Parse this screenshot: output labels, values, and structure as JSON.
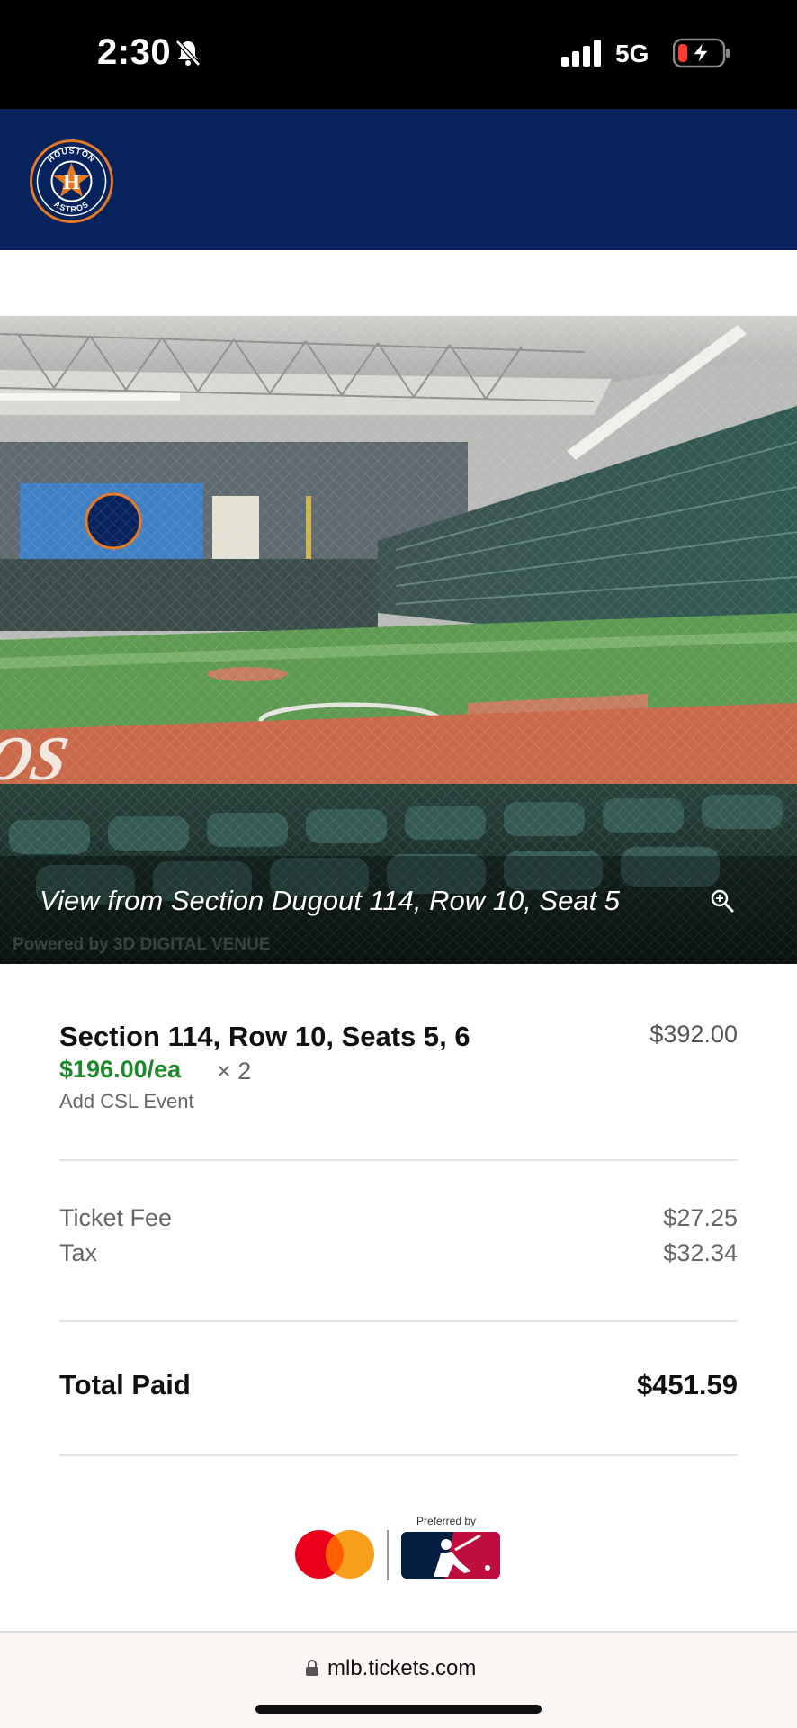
{
  "status_bar": {
    "time": "2:30",
    "network": "5G",
    "icons": [
      "bell-off-icon",
      "signal-icon",
      "battery-charging-icon"
    ]
  },
  "header": {
    "logo": "houston-astros-logo",
    "logo_text_top": "HOUSTON",
    "logo_text_bottom": "ASTROS",
    "background": "#06235e"
  },
  "seat_view": {
    "caption": "View from Section Dugout 114, Row 10, Seat 5",
    "powered_by": "Powered by 3D DIGITAL VENUE",
    "zoom_icon": "zoom-in-icon"
  },
  "order": {
    "seat_title": "Section 114, Row 10, Seats 5, 6",
    "seat_total": "$392.00",
    "price_each": "$196.00/ea",
    "quantity": "× 2",
    "add_csl": "Add CSL Event",
    "fees": [
      {
        "label": "Ticket Fee",
        "value": "$27.25"
      },
      {
        "label": "Tax",
        "value": "$32.34"
      }
    ],
    "total_label": "Total Paid",
    "total_value": "$451.59",
    "accent_green": "#1f8a2b"
  },
  "brands": {
    "preferred_by": "Preferred by",
    "icons": [
      "mastercard-logo",
      "mlb-logo"
    ]
  },
  "browser": {
    "url": "mlb.tickets.com",
    "icon": "lock-icon"
  }
}
